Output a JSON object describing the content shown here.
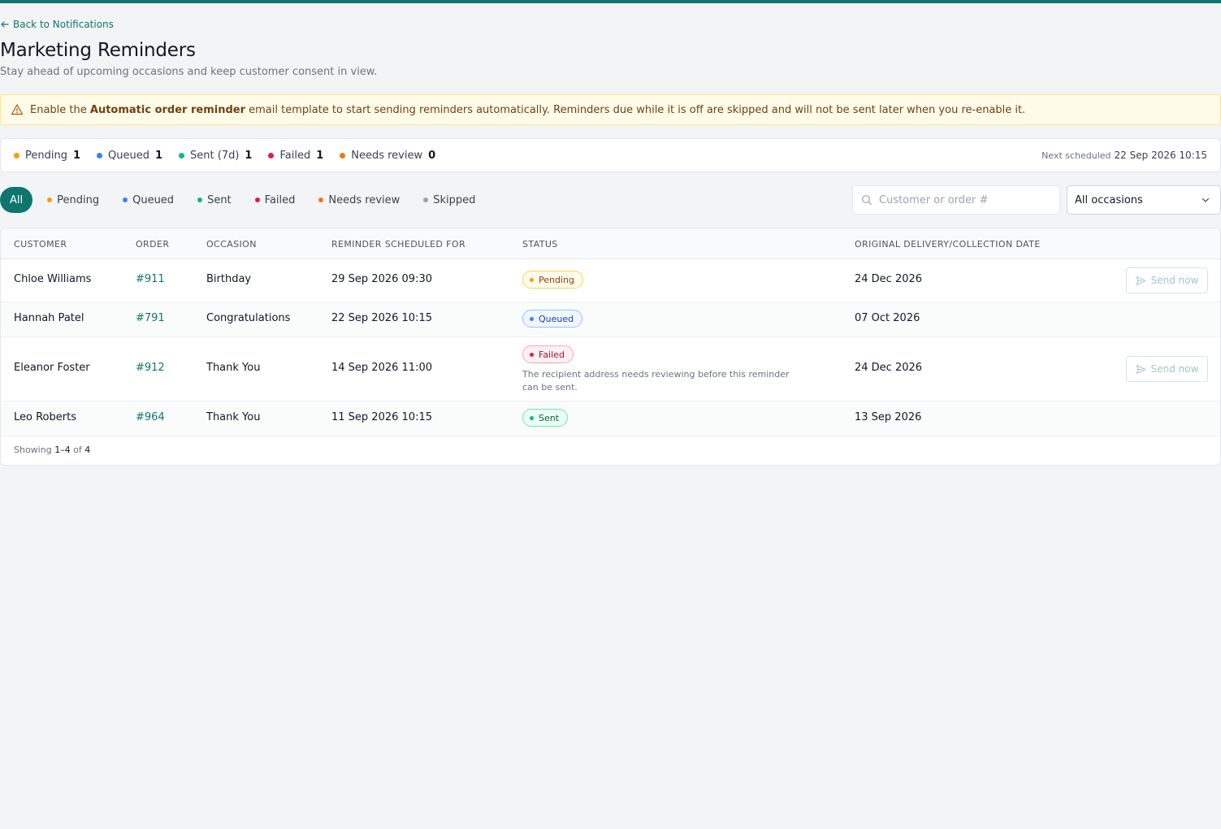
{
  "colors": {
    "accent": "#0f766e",
    "pending": "#f59e0b",
    "queued": "#3b82f6",
    "sent": "#10b981",
    "failed": "#e11d48",
    "needs_review": "#f97316",
    "skipped": "#9ca3af"
  },
  "back_link": {
    "label": "Back to Notifications",
    "icon": "arrow-left-icon"
  },
  "header": {
    "title": "Marketing Reminders",
    "subtitle": "Stay ahead of upcoming occasions and keep customer consent in view."
  },
  "alert": {
    "icon": "warning-triangle-icon",
    "prefix": "Enable the ",
    "bold": "Automatic order reminder",
    "suffix": " email template to start sending reminders automatically. Reminders due while it is off are skipped and will not be sent later when you re-enable it."
  },
  "summary": {
    "items": [
      {
        "label": "Pending",
        "count": "1"
      },
      {
        "label": "Queued",
        "count": "1"
      },
      {
        "label": "Sent (7d)",
        "count": "1"
      },
      {
        "label": "Failed",
        "count": "1"
      },
      {
        "label": "Needs review",
        "count": "0"
      }
    ],
    "next_label": "Next scheduled",
    "next_value": "22 Sep 2026 10:15"
  },
  "filters": {
    "all": "All",
    "items": [
      "Pending",
      "Queued",
      "Sent",
      "Failed",
      "Needs review",
      "Skipped"
    ]
  },
  "search": {
    "placeholder": "Customer or order #",
    "value": "",
    "icon": "search-icon"
  },
  "occasion_select": {
    "value": "All occasions",
    "icon": "chevron-down-icon"
  },
  "table": {
    "columns": [
      "Customer",
      "Order",
      "Occasion",
      "Reminder scheduled for",
      "Status",
      "Original delivery/collection date"
    ],
    "rows": [
      {
        "customer": "Chloe Williams",
        "order": "#911",
        "occasion": "Birthday",
        "scheduled": "29 Sep 2026 09:30",
        "status": "Pending",
        "note": "",
        "date": "24 Dec 2026",
        "action": "Send now"
      },
      {
        "customer": "Hannah Patel",
        "order": "#791",
        "occasion": "Congratulations",
        "scheduled": "22 Sep 2026 10:15",
        "status": "Queued",
        "note": "",
        "date": "07 Oct 2026",
        "action": ""
      },
      {
        "customer": "Eleanor Foster",
        "order": "#912",
        "occasion": "Thank You",
        "scheduled": "14 Sep 2026 11:00",
        "status": "Failed",
        "note": "The recipient address needs reviewing before this reminder can be sent.",
        "date": "24 Dec 2026",
        "action": "Send now"
      },
      {
        "customer": "Leo Roberts",
        "order": "#964",
        "occasion": "Thank You",
        "scheduled": "11 Sep 2026 10:15",
        "status": "Sent",
        "note": "",
        "date": "13 Sep 2026",
        "action": ""
      }
    ]
  },
  "pagination": {
    "prefix": "Showing ",
    "range": "1–4",
    "of": " of ",
    "total": "4"
  }
}
